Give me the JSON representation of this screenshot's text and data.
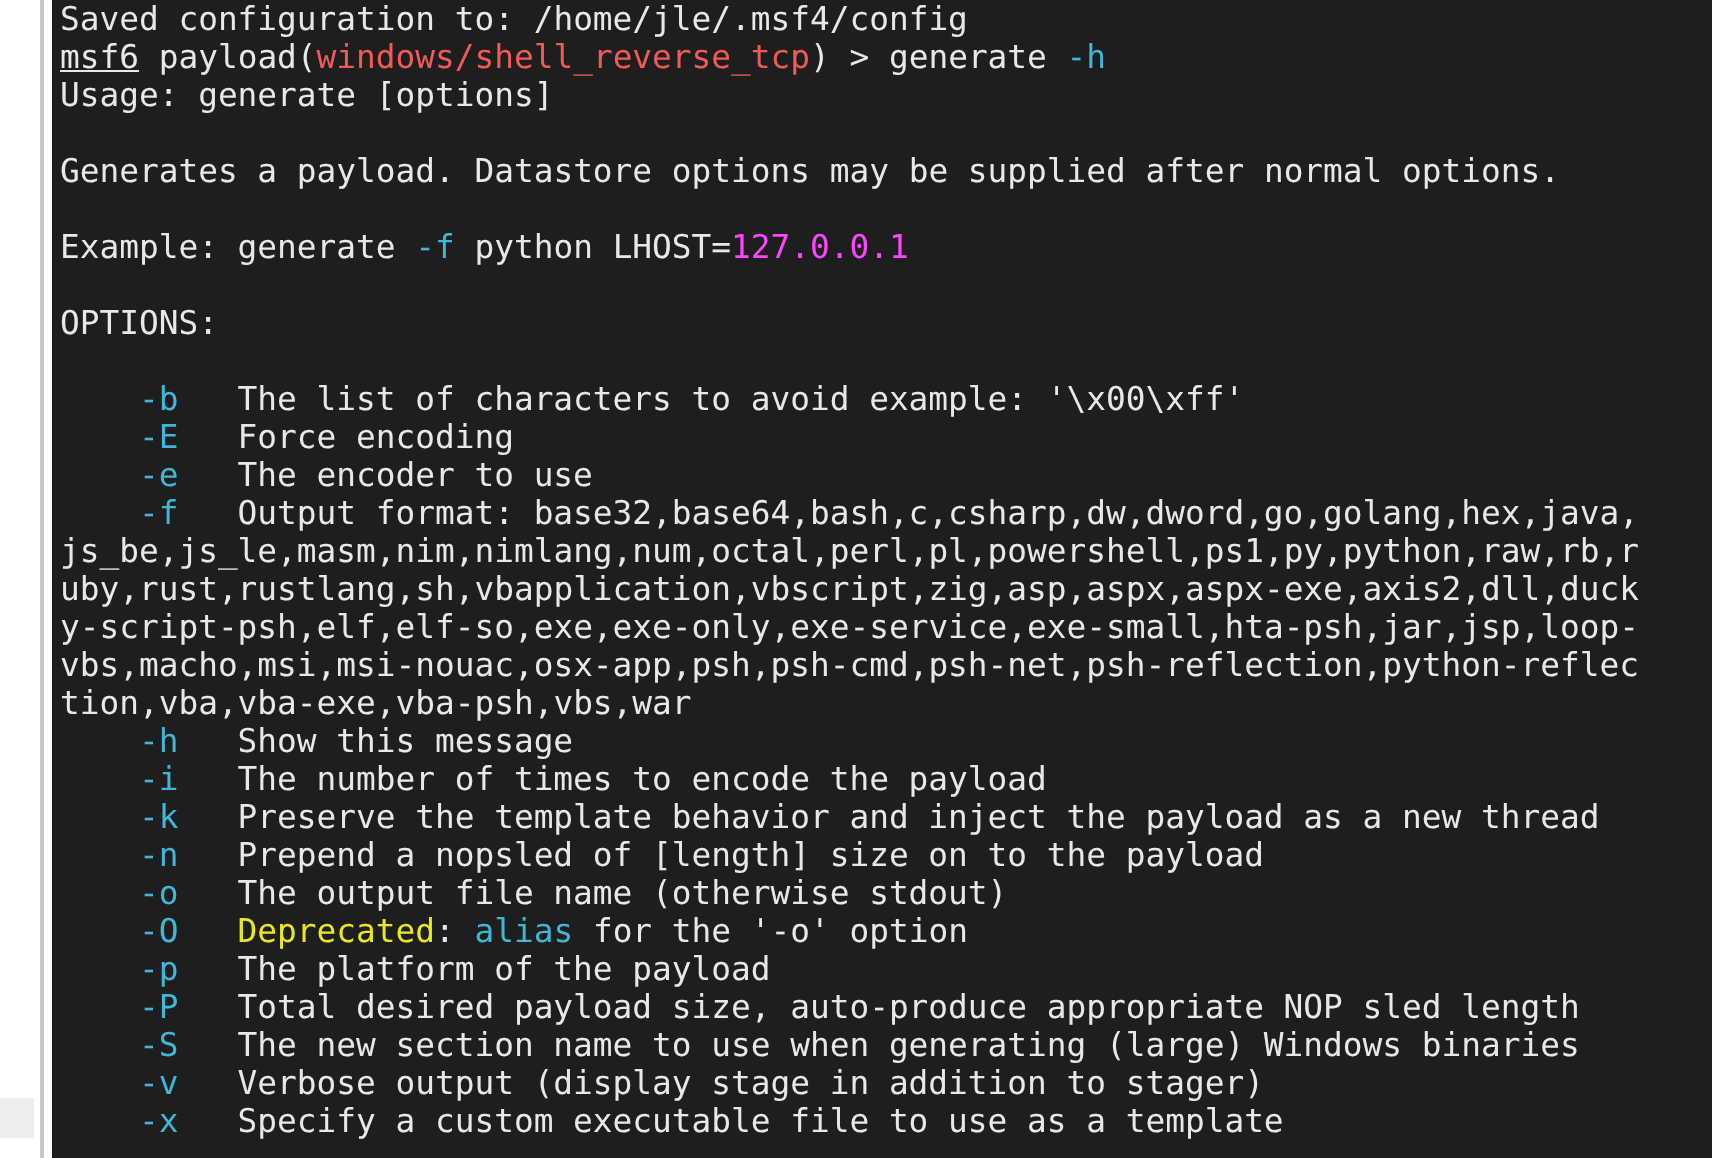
{
  "terminal": {
    "lines": [
      {
        "kind": "text",
        "segments": [
          {
            "kind": "plain",
            "text": "Saved configuration to: /home/jle/.msf4/config"
          }
        ]
      },
      {
        "kind": "text",
        "segments": [
          {
            "kind": "prompt",
            "text": "msf6"
          },
          {
            "kind": "plain",
            "text": " payload("
          },
          {
            "kind": "module",
            "text": "windows/shell_reverse_tcp"
          },
          {
            "kind": "plain",
            "text": ") > generate "
          },
          {
            "kind": "flag",
            "text": "-h"
          }
        ]
      },
      {
        "kind": "text",
        "segments": [
          {
            "kind": "plain",
            "text": "Usage: generate [options]"
          }
        ]
      },
      {
        "kind": "blank"
      },
      {
        "kind": "text",
        "segments": [
          {
            "kind": "plain",
            "text": "Generates a payload. Datastore options may be supplied after normal options."
          }
        ]
      },
      {
        "kind": "blank"
      },
      {
        "kind": "text",
        "segments": [
          {
            "kind": "plain",
            "text": "Example: generate "
          },
          {
            "kind": "flag",
            "text": "-f"
          },
          {
            "kind": "plain",
            "text": " python LHOST="
          },
          {
            "kind": "value",
            "text": "127.0.0.1"
          }
        ]
      },
      {
        "kind": "blank"
      },
      {
        "kind": "text",
        "segments": [
          {
            "kind": "plain",
            "text": "OPTIONS:"
          }
        ]
      },
      {
        "kind": "blank"
      }
    ],
    "options": [
      {
        "flag": "-b",
        "description": [
          {
            "kind": "plain",
            "text": "The list of characters to avoid example: '\\x00\\xff'"
          }
        ]
      },
      {
        "flag": "-E",
        "description": [
          {
            "kind": "plain",
            "text": "Force encoding"
          }
        ]
      },
      {
        "flag": "-e",
        "description": [
          {
            "kind": "plain",
            "text": "The encoder to use"
          }
        ]
      },
      {
        "flag": "-f",
        "description": [
          {
            "kind": "plain",
            "text": "Output format: base32,base64,bash,c,csharp,dw,dword,go,golang,hex,java,js_be,js_le,masm,nim,nimlang,num,octal,perl,pl,powershell,ps1,py,python,raw,rb,ruby,rust,rustlang,sh,vbapplication,vbscript,zig,asp,aspx,aspx-exe,axis2,dll,ducky-script-psh,elf,elf-so,exe,exe-only,exe-service,exe-small,hta-psh,jar,jsp,loop-vbs,macho,msi,msi-nouac,osx-app,psh,psh-cmd,psh-net,psh-reflection,python-reflection,vba,vba-exe,vba-psh,vbs,war"
          }
        ]
      },
      {
        "flag": "-h",
        "description": [
          {
            "kind": "plain",
            "text": "Show this message"
          }
        ]
      },
      {
        "flag": "-i",
        "description": [
          {
            "kind": "plain",
            "text": "The number of times to encode the payload"
          }
        ]
      },
      {
        "flag": "-k",
        "description": [
          {
            "kind": "plain",
            "text": "Preserve the template behavior and inject the payload as a new thread"
          }
        ]
      },
      {
        "flag": "-n",
        "description": [
          {
            "kind": "plain",
            "text": "Prepend a nopsled of [length] size on to the payload"
          }
        ]
      },
      {
        "flag": "-o",
        "description": [
          {
            "kind": "plain",
            "text": "The output file name (otherwise stdout)"
          }
        ]
      },
      {
        "flag": "-O",
        "description": [
          {
            "kind": "warning",
            "text": "Deprecated"
          },
          {
            "kind": "plain",
            "text": ": "
          },
          {
            "kind": "keyword",
            "text": "alias"
          },
          {
            "kind": "plain",
            "text": " for the '-o' option"
          }
        ]
      },
      {
        "flag": "-p",
        "description": [
          {
            "kind": "plain",
            "text": "The platform of the payload"
          }
        ]
      },
      {
        "flag": "-P",
        "description": [
          {
            "kind": "plain",
            "text": "Total desired payload size, auto-produce appropriate NOP sled length"
          }
        ]
      },
      {
        "flag": "-S",
        "description": [
          {
            "kind": "plain",
            "text": "The new section name to use when generating (large) Windows binaries"
          }
        ]
      },
      {
        "flag": "-v",
        "description": [
          {
            "kind": "plain",
            "text": "Verbose output (display stage in addition to stager)"
          }
        ]
      },
      {
        "flag": "-x",
        "description": [
          {
            "kind": "plain",
            "text": "Specify a custom executable file to use as a template"
          }
        ]
      }
    ]
  }
}
